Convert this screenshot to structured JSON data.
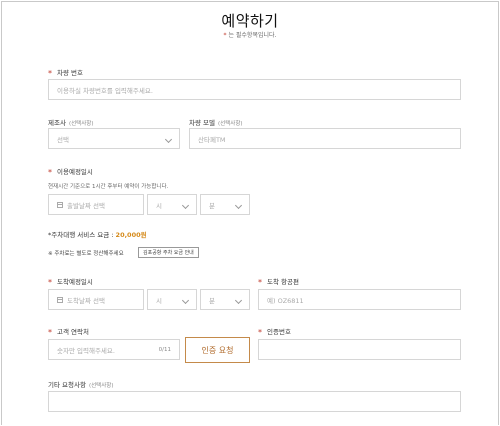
{
  "header": {
    "title": "예약하기",
    "subtitle_star": "*",
    "subtitle_text": "는 필수항목입니다."
  },
  "form": {
    "vehicle_number": {
      "label": "차량 번호",
      "placeholder": "이용하실 차량번호를 입력해주세요."
    },
    "manufacturer": {
      "label": "제조사",
      "optional": "(선택사항)",
      "value": "선택"
    },
    "model": {
      "label": "차량 모델",
      "optional": "(선택사항)",
      "placeholder": "산타페TM"
    },
    "usage_datetime": {
      "label": "이용예정일시",
      "hint": "현재시간 기준으로 1시간 후부터 예약이 가능합니다.",
      "date_placeholder": "출발날짜 선택",
      "hour": "시",
      "minute": "분"
    },
    "service_fee": {
      "label": "주차대행 서비스 요금 :",
      "value": "20,000원"
    },
    "parking_note": {
      "text": "※ 주차료는 별도로 정산해주세요",
      "button": "김포공항 주차 요금 안내"
    },
    "arrival_datetime": {
      "label": "도착예정일시",
      "date_placeholder": "도착날짜 선택",
      "hour": "시",
      "minute": "분"
    },
    "arrival_flight": {
      "label": "도착 항공편",
      "placeholder": "예) OZ6811"
    },
    "contact": {
      "label": "고객 연락처",
      "placeholder": "숫자만 입력해주세요.",
      "counter": "0/11",
      "verify_button": "인증 요청"
    },
    "verification_code": {
      "label": "인증번호",
      "placeholder": ""
    },
    "other_requests": {
      "label": "기타 요청사항",
      "optional": "(선택사항)",
      "placeholder": ""
    }
  },
  "colors": {
    "accent": "#d58a1a",
    "required": "#c0392b",
    "button_border": "#c48a4a"
  }
}
